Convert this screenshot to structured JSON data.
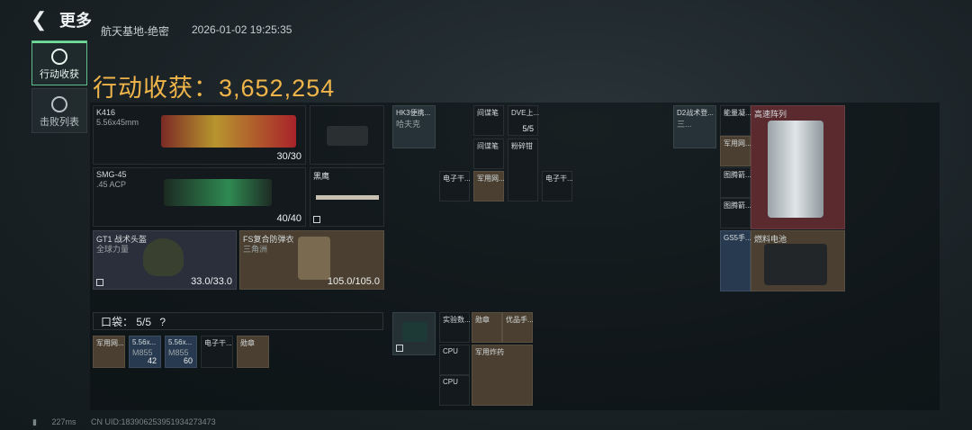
{
  "header": {
    "title": "更多"
  },
  "nav": [
    {
      "label": "行动收获",
      "active": true
    },
    {
      "label": "击败列表",
      "active": false
    }
  ],
  "raid": {
    "map": "航天基地-绝密",
    "datetime": "2026-01-02 19:25:35",
    "haul_label": "行动收获：",
    "haul_value": "3,652,254"
  },
  "gear": {
    "primary": {
      "name": "K416",
      "sub": "5.56x45mm",
      "ammo": "30/30"
    },
    "secondary": {
      "name": "SMG-45",
      "sub": ".45 ACP",
      "ammo": "40/40"
    },
    "pistol": {
      "name": ""
    },
    "melee": {
      "name": "黑鹰"
    },
    "helmet": {
      "name": "GT1 战术头盔",
      "sub": "全球力量",
      "dur": "33.0/33.0"
    },
    "armor": {
      "name": "FS复合防弹衣",
      "sub": "三角洲",
      "dur": "105.0/105.0"
    }
  },
  "pocket": {
    "label": "口袋：",
    "count": "5/5",
    "help": "?",
    "items": [
      {
        "name": "军用网...",
        "cnt": ""
      },
      {
        "name": "5.56x...",
        "sub": "M855",
        "cnt": "42"
      },
      {
        "name": "5.56x...",
        "sub": "M855",
        "cnt": "60"
      },
      {
        "name": "电子干...",
        "cnt": ""
      },
      {
        "name": "勋章",
        "cnt": ""
      }
    ]
  },
  "chest": {
    "items": [
      {
        "name": "HK3便携...",
        "sub": "哈夫克"
      },
      {
        "name": "间谍笔"
      },
      {
        "name": "DVE上...",
        "cnt": "5/5"
      },
      {
        "name": "间谍笔"
      },
      {
        "name": "粉碎钳"
      },
      {
        "name": "电子干..."
      },
      {
        "name": "军用网..."
      },
      {
        "name": "电子干..."
      }
    ]
  },
  "backpack": {
    "items": [
      {
        "name": "实验数..."
      },
      {
        "name": "勋章"
      },
      {
        "name": "优品手..."
      },
      {
        "name": "CPU"
      },
      {
        "name": "军用炸药"
      },
      {
        "name": "CPU"
      }
    ]
  },
  "case": {
    "items": [
      {
        "name": "D2战术登...",
        "sub": "三..."
      },
      {
        "name": "能量凝..."
      },
      {
        "name": "高速阵列"
      },
      {
        "name": "军用网..."
      },
      {
        "name": "图腾箭..."
      },
      {
        "name": "图腾箭..."
      },
      {
        "name": "GS5手..."
      },
      {
        "name": "燃料电池"
      }
    ]
  },
  "status": {
    "ping": "227ms",
    "uid": "CN UID:1839062539519342734​73"
  }
}
